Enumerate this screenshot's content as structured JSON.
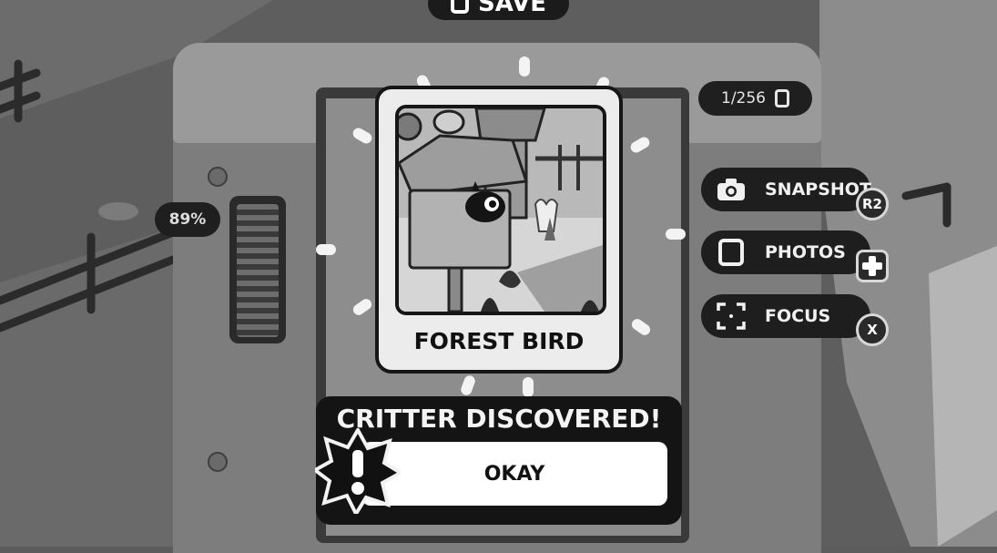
{
  "header": {
    "save_label": "SAVE"
  },
  "camera": {
    "photo_counter": "1/256",
    "battery_level": "89%"
  },
  "actions": [
    {
      "label": "SNAPSHOT",
      "icon": "camera-icon",
      "hint": "R2"
    },
    {
      "label": "PHOTOS",
      "icon": "photo-frame-icon",
      "hint": "dpad-icon"
    },
    {
      "label": "FOCUS",
      "icon": "focus-brackets-icon",
      "hint": "X"
    }
  ],
  "discovery": {
    "critter_name": "FOREST BIRD",
    "title": "CRITTER DISCOVERED!",
    "button_label": "OKAY",
    "badge_icon": "exclamation-icon"
  }
}
